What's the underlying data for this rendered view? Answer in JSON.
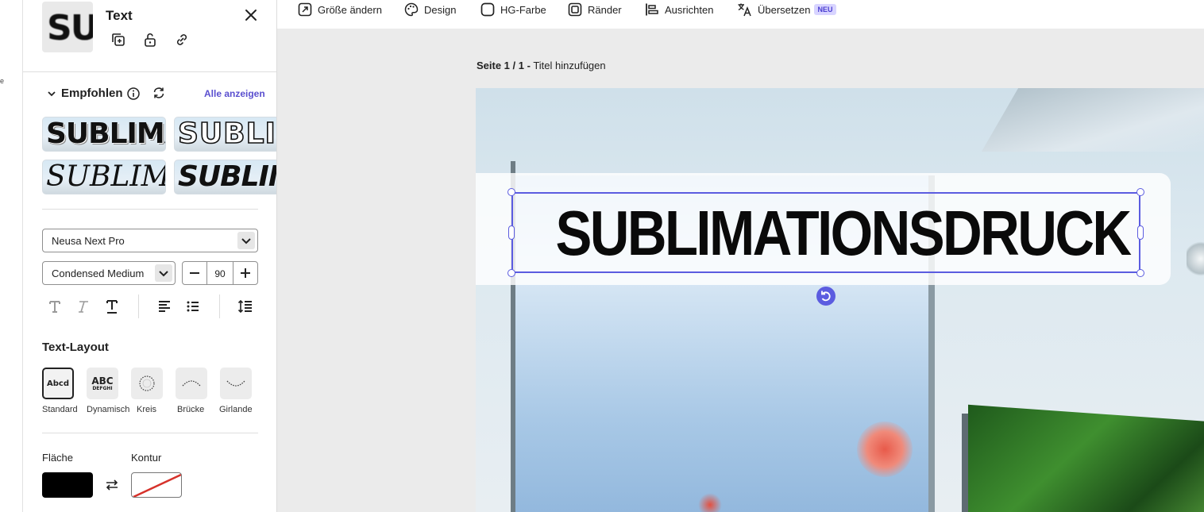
{
  "rail": {
    "stub_text": "e"
  },
  "panel": {
    "title": "Text",
    "thumb_text": "SU",
    "recommended": {
      "title": "Empfohlen",
      "show_all": "Alle anzeigen",
      "styles": [
        "SUBLIMATIONSDRUCK",
        "SUBLIMATIONSDRUCK",
        "SUBLIMATIONSDRUCK",
        "SUBLIMATIONSDRUCK"
      ]
    },
    "font_family": "Neusa Next Pro",
    "font_weight": "Condensed Medium",
    "font_size": "90",
    "text_layout": {
      "title": "Text-Layout",
      "options": [
        {
          "label": "Standard",
          "preview": "Abcd"
        },
        {
          "label": "Dynamisch",
          "preview": "ABC",
          "preview2": "DEFGHI"
        },
        {
          "label": "Kreis"
        },
        {
          "label": "Brücke"
        },
        {
          "label": "Girlande"
        }
      ]
    },
    "fill_label": "Fläche",
    "stroke_label": "Kontur",
    "fill_color": "#000000"
  },
  "toolbar": {
    "items": [
      {
        "label": "Größe ändern"
      },
      {
        "label": "Design"
      },
      {
        "label": "HG-Farbe"
      },
      {
        "label": "Ränder"
      },
      {
        "label": "Ausrichten"
      },
      {
        "label": "Übersetzen",
        "badge": "NEU"
      }
    ]
  },
  "page": {
    "counter": "Seite 1 / 1 -",
    "title_placeholder": "Titel hinzufügen"
  },
  "canvas": {
    "headline": "SUBLIMATIONSDRUCK",
    "selection_color": "#5b5ce0"
  },
  "colors": {
    "accent": "#5a4fcf"
  }
}
